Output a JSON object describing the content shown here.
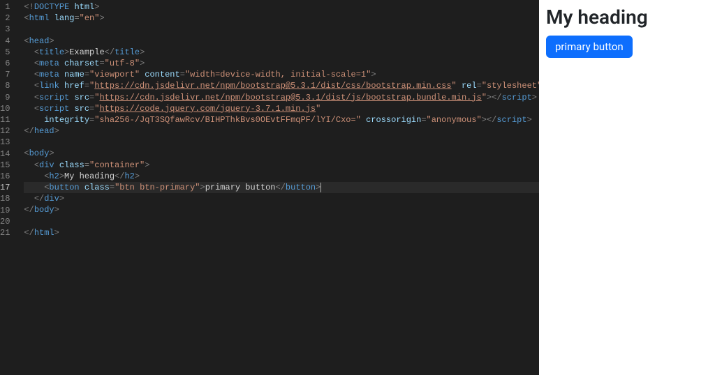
{
  "editor": {
    "active_line": 17,
    "lines": [
      {
        "n": 1,
        "segs": [
          {
            "c": "punc",
            "t": "<!"
          },
          {
            "c": "tag",
            "t": "DOCTYPE"
          },
          {
            "c": "text",
            "t": " "
          },
          {
            "c": "attr",
            "t": "html"
          },
          {
            "c": "punc",
            "t": ">"
          }
        ]
      },
      {
        "n": 2,
        "segs": [
          {
            "c": "punc",
            "t": "<"
          },
          {
            "c": "tag",
            "t": "html"
          },
          {
            "c": "text",
            "t": " "
          },
          {
            "c": "attr",
            "t": "lang"
          },
          {
            "c": "punc",
            "t": "="
          },
          {
            "c": "str",
            "t": "\"en\""
          },
          {
            "c": "punc",
            "t": ">"
          }
        ]
      },
      {
        "n": 3,
        "segs": []
      },
      {
        "n": 4,
        "segs": [
          {
            "c": "punc",
            "t": "<"
          },
          {
            "c": "tag",
            "t": "head"
          },
          {
            "c": "punc",
            "t": ">"
          }
        ]
      },
      {
        "n": 5,
        "indent": 1,
        "segs": [
          {
            "c": "punc",
            "t": "<"
          },
          {
            "c": "tag",
            "t": "title"
          },
          {
            "c": "punc",
            "t": ">"
          },
          {
            "c": "text",
            "t": "Example"
          },
          {
            "c": "punc",
            "t": "</"
          },
          {
            "c": "tag",
            "t": "title"
          },
          {
            "c": "punc",
            "t": ">"
          }
        ]
      },
      {
        "n": 6,
        "indent": 1,
        "segs": [
          {
            "c": "punc",
            "t": "<"
          },
          {
            "c": "tag",
            "t": "meta"
          },
          {
            "c": "text",
            "t": " "
          },
          {
            "c": "attr",
            "t": "charset"
          },
          {
            "c": "punc",
            "t": "="
          },
          {
            "c": "str",
            "t": "\"utf-8\""
          },
          {
            "c": "punc",
            "t": ">"
          }
        ]
      },
      {
        "n": 7,
        "indent": 1,
        "segs": [
          {
            "c": "punc",
            "t": "<"
          },
          {
            "c": "tag",
            "t": "meta"
          },
          {
            "c": "text",
            "t": " "
          },
          {
            "c": "attr",
            "t": "name"
          },
          {
            "c": "punc",
            "t": "="
          },
          {
            "c": "str",
            "t": "\"viewport\""
          },
          {
            "c": "text",
            "t": " "
          },
          {
            "c": "attr",
            "t": "content"
          },
          {
            "c": "punc",
            "t": "="
          },
          {
            "c": "str",
            "t": "\"width=device-width, initial-scale=1\""
          },
          {
            "c": "punc",
            "t": ">"
          }
        ]
      },
      {
        "n": 8,
        "indent": 1,
        "segs": [
          {
            "c": "punc",
            "t": "<"
          },
          {
            "c": "tag",
            "t": "link"
          },
          {
            "c": "text",
            "t": " "
          },
          {
            "c": "attr",
            "t": "href"
          },
          {
            "c": "punc",
            "t": "="
          },
          {
            "c": "str",
            "t": "\""
          },
          {
            "c": "url",
            "t": "https://cdn.jsdelivr.net/npm/bootstrap@5.3.1/dist/css/bootstrap.min.css"
          },
          {
            "c": "str",
            "t": "\""
          },
          {
            "c": "text",
            "t": " "
          },
          {
            "c": "attr",
            "t": "rel"
          },
          {
            "c": "punc",
            "t": "="
          },
          {
            "c": "str",
            "t": "\"stylesheet\""
          },
          {
            "c": "punc",
            "t": ">"
          }
        ]
      },
      {
        "n": 9,
        "indent": 1,
        "segs": [
          {
            "c": "punc",
            "t": "<"
          },
          {
            "c": "tag",
            "t": "script"
          },
          {
            "c": "text",
            "t": " "
          },
          {
            "c": "attr",
            "t": "src"
          },
          {
            "c": "punc",
            "t": "="
          },
          {
            "c": "str",
            "t": "\""
          },
          {
            "c": "url",
            "t": "https://cdn.jsdelivr.net/npm/bootstrap@5.3.1/dist/js/bootstrap.bundle.min.js"
          },
          {
            "c": "str",
            "t": "\""
          },
          {
            "c": "punc",
            "t": "></"
          },
          {
            "c": "tag",
            "t": "script"
          },
          {
            "c": "punc",
            "t": ">"
          }
        ]
      },
      {
        "n": 10,
        "indent": 1,
        "segs": [
          {
            "c": "punc",
            "t": "<"
          },
          {
            "c": "tag",
            "t": "script"
          },
          {
            "c": "text",
            "t": " "
          },
          {
            "c": "attr",
            "t": "src"
          },
          {
            "c": "punc",
            "t": "="
          },
          {
            "c": "str",
            "t": "\""
          },
          {
            "c": "url",
            "t": "https://code.jquery.com/jquery-3.7.1.min.js"
          },
          {
            "c": "str",
            "t": "\""
          }
        ]
      },
      {
        "n": 11,
        "indent": 2,
        "segs": [
          {
            "c": "attr",
            "t": "integrity"
          },
          {
            "c": "punc",
            "t": "="
          },
          {
            "c": "str",
            "t": "\"sha256-/JqT3SQfawRcv/BIHPThkBvs0OEvtFFmqPF/lYI/Cxo=\""
          },
          {
            "c": "text",
            "t": " "
          },
          {
            "c": "attr",
            "t": "crossorigin"
          },
          {
            "c": "punc",
            "t": "="
          },
          {
            "c": "str",
            "t": "\"anonymous\""
          },
          {
            "c": "punc",
            "t": "></"
          },
          {
            "c": "tag",
            "t": "script"
          },
          {
            "c": "punc",
            "t": ">"
          }
        ]
      },
      {
        "n": 12,
        "segs": [
          {
            "c": "punc",
            "t": "</"
          },
          {
            "c": "tag",
            "t": "head"
          },
          {
            "c": "punc",
            "t": ">"
          }
        ]
      },
      {
        "n": 13,
        "segs": []
      },
      {
        "n": 14,
        "segs": [
          {
            "c": "punc",
            "t": "<"
          },
          {
            "c": "tag",
            "t": "body"
          },
          {
            "c": "punc",
            "t": ">"
          }
        ]
      },
      {
        "n": 15,
        "indent": 1,
        "segs": [
          {
            "c": "punc",
            "t": "<"
          },
          {
            "c": "tag",
            "t": "div"
          },
          {
            "c": "text",
            "t": " "
          },
          {
            "c": "attr",
            "t": "class"
          },
          {
            "c": "punc",
            "t": "="
          },
          {
            "c": "str",
            "t": "\"container\""
          },
          {
            "c": "punc",
            "t": ">"
          }
        ]
      },
      {
        "n": 16,
        "indent": 2,
        "segs": [
          {
            "c": "punc",
            "t": "<"
          },
          {
            "c": "tag",
            "t": "h2"
          },
          {
            "c": "punc",
            "t": ">"
          },
          {
            "c": "text",
            "t": "My heading"
          },
          {
            "c": "punc",
            "t": "</"
          },
          {
            "c": "tag",
            "t": "h2"
          },
          {
            "c": "punc",
            "t": ">"
          }
        ]
      },
      {
        "n": 17,
        "indent": 2,
        "segs": [
          {
            "c": "punc",
            "t": "<"
          },
          {
            "c": "tag",
            "t": "button"
          },
          {
            "c": "text",
            "t": " "
          },
          {
            "c": "attr",
            "t": "class"
          },
          {
            "c": "punc",
            "t": "="
          },
          {
            "c": "str",
            "t": "\"btn btn-primary\""
          },
          {
            "c": "punc",
            "t": ">"
          },
          {
            "c": "text",
            "t": "primary button"
          },
          {
            "c": "punc",
            "t": "</"
          },
          {
            "c": "tag",
            "t": "button"
          },
          {
            "c": "punc",
            "t": ">"
          }
        ],
        "cursor": true
      },
      {
        "n": 18,
        "indent": 1,
        "segs": [
          {
            "c": "punc",
            "t": "</"
          },
          {
            "c": "tag",
            "t": "div"
          },
          {
            "c": "punc",
            "t": ">"
          }
        ]
      },
      {
        "n": 19,
        "segs": [
          {
            "c": "punc",
            "t": "</"
          },
          {
            "c": "tag",
            "t": "body"
          },
          {
            "c": "punc",
            "t": ">"
          }
        ]
      },
      {
        "n": 20,
        "segs": []
      },
      {
        "n": 21,
        "segs": [
          {
            "c": "punc",
            "t": "</"
          },
          {
            "c": "tag",
            "t": "html"
          },
          {
            "c": "punc",
            "t": ">"
          }
        ]
      }
    ]
  },
  "preview": {
    "heading": "My heading",
    "button_label": "primary button"
  }
}
